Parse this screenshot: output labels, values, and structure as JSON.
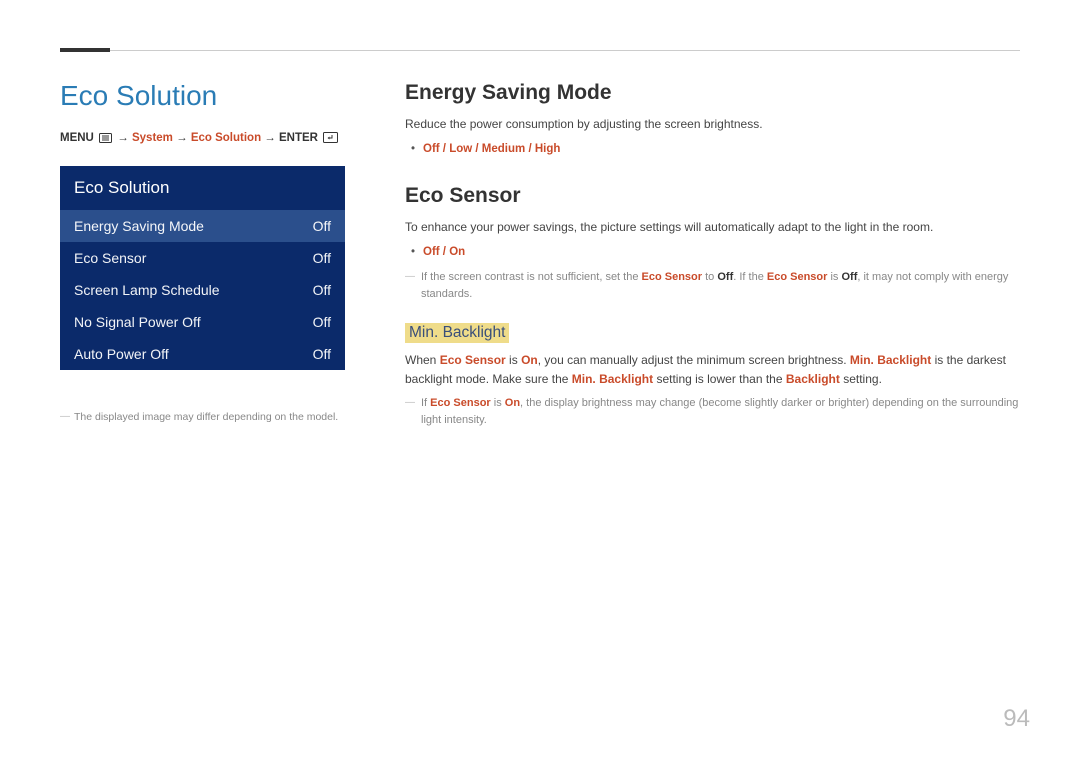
{
  "page_number": "94",
  "left": {
    "title": "Eco Solution",
    "breadcrumb": {
      "menu_label": "MENU",
      "arrow": "→",
      "system": "System",
      "eco": "Eco Solution",
      "enter_label": "ENTER"
    },
    "panel": {
      "header": "Eco Solution",
      "rows": [
        {
          "label": "Energy Saving Mode",
          "value": "Off",
          "selected": true
        },
        {
          "label": "Eco Sensor",
          "value": "Off",
          "selected": false
        },
        {
          "label": "Screen Lamp Schedule",
          "value": "Off",
          "selected": false
        },
        {
          "label": "No Signal Power Off",
          "value": "Off",
          "selected": false
        },
        {
          "label": "Auto Power Off",
          "value": "Off",
          "selected": false
        }
      ]
    },
    "footnote": "The displayed image may differ depending on the model."
  },
  "right": {
    "energy_saving": {
      "heading": "Energy Saving Mode",
      "desc": "Reduce the power consumption by adjusting the screen brightness.",
      "options": [
        "Off",
        "Low",
        "Medium",
        "High"
      ]
    },
    "eco_sensor": {
      "heading": "Eco Sensor",
      "desc": "To enhance your power savings, the picture settings will automatically adapt to the light in the room.",
      "options": [
        "Off",
        "On"
      ],
      "note_parts": {
        "p1": "If the screen contrast is not sufficient, set the ",
        "t1": "Eco Sensor",
        "p2": " to ",
        "t2": "Off",
        "p3": ". If the ",
        "t3": "Eco Sensor",
        "p4": " is ",
        "t4": "Off",
        "p5": ", it may not comply with energy standards."
      }
    },
    "min_backlight": {
      "heading": "Min. Backlight",
      "desc_parts": {
        "p1": "When ",
        "t1": "Eco Sensor",
        "p2": " is ",
        "t2": "On",
        "p3": ", you can manually adjust the minimum screen brightness. ",
        "t3": "Min. Backlight",
        "p4": " is the darkest backlight mode. Make sure the ",
        "t4": "Min. Backlight",
        "p5": " setting is lower than the ",
        "t5": "Backlight",
        "p6": " setting."
      },
      "note_parts": {
        "p1": "If ",
        "t1": "Eco Sensor",
        "p2": " is ",
        "t2": "On",
        "p3": ", the display brightness may change (become slightly darker or brighter) depending on the surrounding light intensity."
      }
    }
  }
}
